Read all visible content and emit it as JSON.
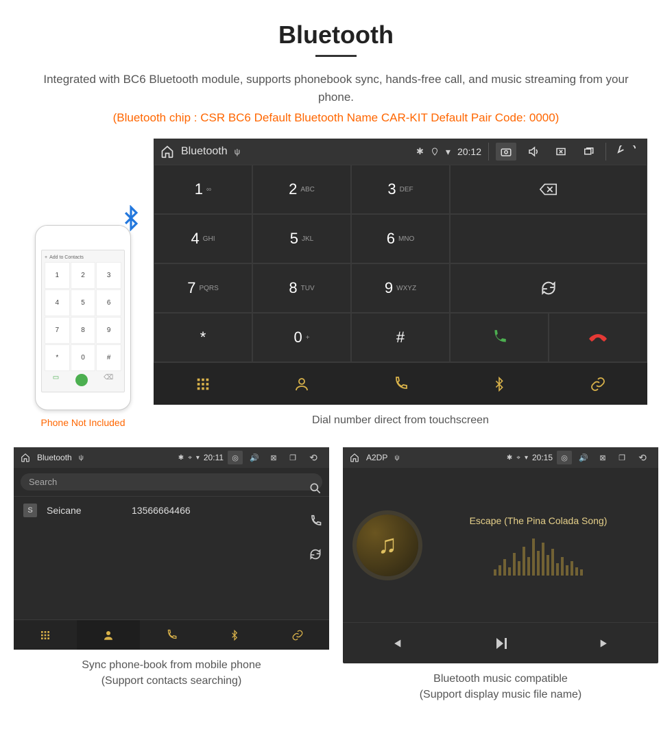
{
  "header": {
    "title": "Bluetooth",
    "description": "Integrated with BC6 Bluetooth module, supports phonebook sync, hands-free call, and music streaming from your phone.",
    "specs": "(Bluetooth chip : CSR BC6    Default Bluetooth Name CAR-KIT    Default Pair Code: 0000)"
  },
  "phone": {
    "add_contacts": "Add to Contacts",
    "caption": "Phone Not Included",
    "keys": [
      "1",
      "2",
      "3",
      "4",
      "5",
      "6",
      "7",
      "8",
      "9",
      "*",
      "0",
      "#"
    ]
  },
  "dialer": {
    "statusbar": {
      "title": "Bluetooth",
      "time": "20:12"
    },
    "keys": [
      {
        "num": "1",
        "lbl": "∞"
      },
      {
        "num": "2",
        "lbl": "ABC"
      },
      {
        "num": "3",
        "lbl": "DEF"
      },
      {
        "num": "4",
        "lbl": "GHI"
      },
      {
        "num": "5",
        "lbl": "JKL"
      },
      {
        "num": "6",
        "lbl": "MNO"
      },
      {
        "num": "7",
        "lbl": "PQRS"
      },
      {
        "num": "8",
        "lbl": "TUV"
      },
      {
        "num": "9",
        "lbl": "WXYZ"
      },
      {
        "num": "*",
        "lbl": ""
      },
      {
        "num": "0",
        "lbl": "+"
      },
      {
        "num": "#",
        "lbl": ""
      }
    ],
    "caption": "Dial number direct from touchscreen"
  },
  "phonebook": {
    "statusbar": {
      "title": "Bluetooth",
      "time": "20:11"
    },
    "search_placeholder": "Search",
    "contact": {
      "initial": "S",
      "name": "Seicane",
      "number": "13566664466"
    },
    "caption1": "Sync phone-book from mobile phone",
    "caption2": "(Support contacts searching)"
  },
  "music": {
    "statusbar": {
      "title": "A2DP",
      "time": "20:15"
    },
    "song": "Escape (The Pina Colada Song)",
    "caption1": "Bluetooth music compatible",
    "caption2": "(Support display music file name)"
  }
}
